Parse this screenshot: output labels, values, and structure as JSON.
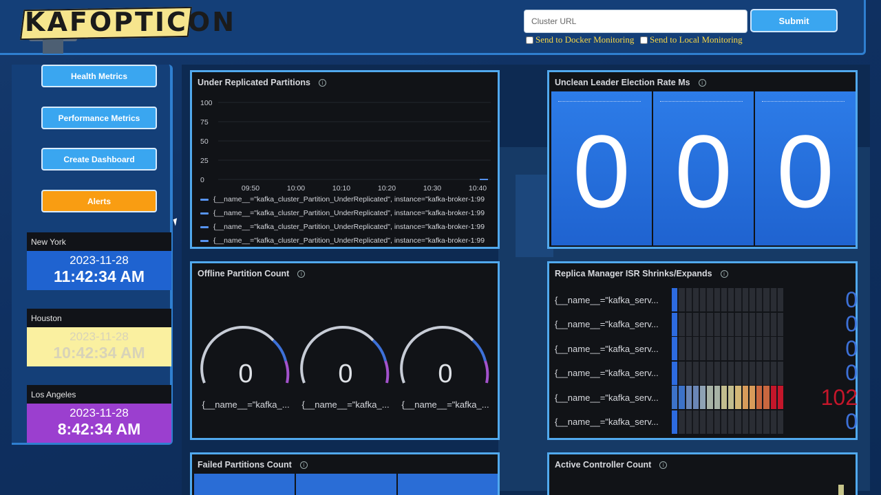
{
  "app": {
    "logo_text": "KAFOPTICON"
  },
  "header": {
    "url_placeholder": "Cluster URL",
    "submit_label": "Submit",
    "docker_label": "Send to Docker Monitoring",
    "local_label": "Send to Local Monitoring"
  },
  "sidebar": {
    "buttons": [
      {
        "label": "Health Metrics"
      },
      {
        "label": "Performance Metrics"
      },
      {
        "label": "Create Dashboard"
      },
      {
        "label": "Alerts"
      }
    ],
    "clocks": [
      {
        "city": "New York",
        "date": "2023-11-28",
        "time": "11:42:34 AM",
        "bg": "#1f63d0",
        "fg": "#ffffff"
      },
      {
        "city": "Houston",
        "date": "2023-11-28",
        "time": "10:42:34 AM",
        "bg": "#faf0a0",
        "fg": "#d8d3b8"
      },
      {
        "city": "Los Angeles",
        "date": "2023-11-28",
        "time": "8:42:34 AM",
        "bg": "#9b3fcf",
        "fg": "#ffffff"
      }
    ]
  },
  "panels": {
    "under_replicated": {
      "title": "Under Replicated Partitions",
      "chart_data": {
        "type": "line",
        "title": "Under Replicated Partitions",
        "x": [
          "09:50",
          "10:00",
          "10:10",
          "10:20",
          "10:30",
          "10:40"
        ],
        "yticks": [
          "100",
          "75",
          "50",
          "25",
          "0"
        ],
        "ylim": [
          0,
          100
        ],
        "series": [
          {
            "name": "{__name__=\"kafka_cluster_Partition_UnderReplicated\", instance=\"kafka-broker-1:99",
            "values": [
              0
            ]
          },
          {
            "name": "{__name__=\"kafka_cluster_Partition_UnderReplicated\", instance=\"kafka-broker-1:99",
            "values": [
              0
            ]
          },
          {
            "name": "{__name__=\"kafka_cluster_Partition_UnderReplicated\", instance=\"kafka-broker-1:99",
            "values": [
              0
            ]
          },
          {
            "name": "{__name__=\"kafka_cluster_Partition_UnderReplicated\", instance=\"kafka-broker-1:99",
            "values": [
              0
            ]
          }
        ],
        "line_color": "#5794f2"
      }
    },
    "unclean_leader": {
      "title": "Unclean Leader Election Rate Ms",
      "values": [
        "0",
        "0",
        "0"
      ]
    },
    "offline_partition": {
      "title": "Offline Partition Count",
      "gauges": [
        {
          "value": "0",
          "label": "{__name__=\"kafka_..."
        },
        {
          "value": "0",
          "label": "{__name__=\"kafka_..."
        },
        {
          "value": "0",
          "label": "{__name__=\"kafka_..."
        }
      ]
    },
    "isr": {
      "title": "Replica Manager ISR Shrinks/Expands",
      "rows": [
        {
          "label": "{__name__=\"kafka_serv...",
          "value": "0",
          "level": 0
        },
        {
          "label": "{__name__=\"kafka_serv...",
          "value": "0",
          "level": 0
        },
        {
          "label": "{__name__=\"kafka_serv...",
          "value": "0",
          "level": 0
        },
        {
          "label": "{__name__=\"kafka_serv...",
          "value": "0",
          "level": 0
        },
        {
          "label": "{__name__=\"kafka_serv...",
          "value": "102",
          "level": 1
        },
        {
          "label": "{__name__=\"kafka_serv...",
          "value": "0",
          "level": 0
        }
      ]
    },
    "failed_partitions": {
      "title": "Failed Partitions Count"
    },
    "active_controller": {
      "title": "Active Controller Count"
    }
  },
  "colors": {
    "accent": "#3aa6f0",
    "alert": "#f99d12",
    "panel_border": "#51a9ee",
    "stat_blue": "#2d7ce8",
    "isr_high": "#c4162a"
  }
}
